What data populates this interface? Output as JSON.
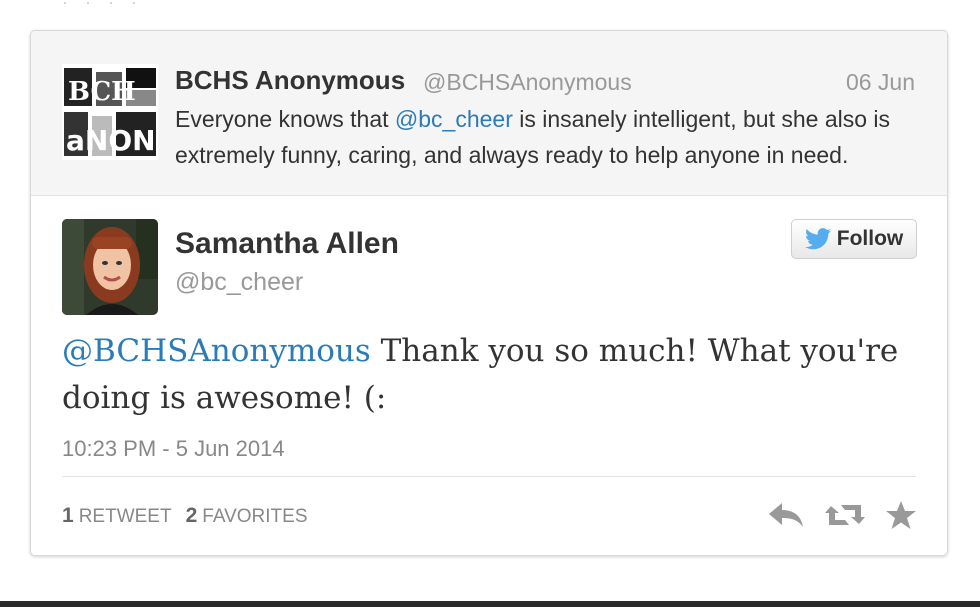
{
  "parent_tweet": {
    "name": "BCHS Anonymous",
    "handle": "@BCHSAnonymous",
    "date": "06 Jun",
    "text_before": "Everyone knows that ",
    "mention": "@bc_cheer",
    "text_after": " is insanely intelligent, but she also is extremely funny, caring, and always ready to help anyone in need.",
    "avatar_text": [
      "BCH",
      "aNON"
    ]
  },
  "tweet": {
    "name": "Samantha Allen",
    "handle": "@bc_cheer",
    "follow_label": "Follow",
    "mention": "@BCHSAnonymous",
    "text": " Thank you so much! What you're doing is awesome! (:",
    "timestamp": "10:23 PM - 5 Jun 2014",
    "retweets_count": "1",
    "retweets_label": "Retweet",
    "favorites_count": "2",
    "favorites_label": "Favorites"
  },
  "colors": {
    "link": "#2b7bb9",
    "twitter_bird": "#55acee"
  },
  "icons": [
    "twitter-bird-icon",
    "reply-icon",
    "retweet-icon",
    "favorite-star-icon"
  ]
}
